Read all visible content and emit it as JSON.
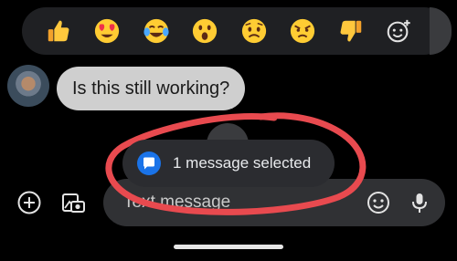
{
  "reactions": [
    {
      "name": "thumbs-up"
    },
    {
      "name": "heart-eyes"
    },
    {
      "name": "tears-of-joy"
    },
    {
      "name": "surprised"
    },
    {
      "name": "sad"
    },
    {
      "name": "angry"
    },
    {
      "name": "thumbs-down"
    },
    {
      "name": "add-reaction"
    }
  ],
  "message": {
    "text": "Is this still working?"
  },
  "toast": {
    "text": "1 message selected"
  },
  "compose": {
    "placeholder": "Text message"
  },
  "colors": {
    "background": "#000000",
    "bubble": "#cfcfcf",
    "toast": "#2b2c30",
    "scribble": "#e84a4f",
    "accent": "#1a73e8"
  }
}
